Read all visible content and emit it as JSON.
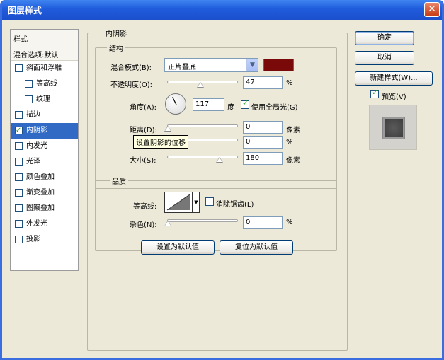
{
  "window": {
    "title": "图层样式"
  },
  "style_list": {
    "header": "样式",
    "blend_options": "混合选项:默认",
    "items": [
      {
        "label": "斜面和浮雕",
        "checked": false,
        "indent": false,
        "selected": false
      },
      {
        "label": "等高线",
        "checked": false,
        "indent": true,
        "selected": false
      },
      {
        "label": "纹理",
        "checked": false,
        "indent": true,
        "selected": false
      },
      {
        "label": "描边",
        "checked": false,
        "indent": false,
        "selected": false
      },
      {
        "label": "内阴影",
        "checked": true,
        "indent": false,
        "selected": true
      },
      {
        "label": "内发光",
        "checked": false,
        "indent": false,
        "selected": false
      },
      {
        "label": "光泽",
        "checked": false,
        "indent": false,
        "selected": false
      },
      {
        "label": "颜色叠加",
        "checked": false,
        "indent": false,
        "selected": false
      },
      {
        "label": "渐变叠加",
        "checked": false,
        "indent": false,
        "selected": false
      },
      {
        "label": "图案叠加",
        "checked": false,
        "indent": false,
        "selected": false
      },
      {
        "label": "外发光",
        "checked": false,
        "indent": false,
        "selected": false
      },
      {
        "label": "投影",
        "checked": false,
        "indent": false,
        "selected": false
      }
    ]
  },
  "inner_shadow": {
    "group_title": "内阴影",
    "structure": {
      "title": "结构",
      "blend_mode_label": "混合模式(B):",
      "blend_mode_value": "正片叠底",
      "shadow_color": "#7a0a0a",
      "opacity_label": "不透明度(O):",
      "opacity_value": "47",
      "opacity_unit": "%",
      "opacity_fraction": 0.47,
      "angle_label": "角度(A):",
      "angle_value": "117",
      "angle_unit": "度",
      "global_light_label": "使用全局光(G)",
      "global_light_checked": true,
      "distance_label": "距离(D):",
      "distance_value": "0",
      "distance_unit": "像素",
      "choke_value": "0",
      "choke_unit": "%",
      "size_label": "大小(S):",
      "size_value": "180",
      "size_unit": "像素",
      "tooltip": "设置阴影的位移"
    },
    "quality": {
      "title": "品质",
      "contour_label": "等高线:",
      "antialias_label": "消除锯齿(L)",
      "antialias_checked": false,
      "noise_label": "杂色(N):",
      "noise_value": "0",
      "noise_unit": "%"
    },
    "make_default": "设置为默认值",
    "reset_default": "复位为默认值"
  },
  "buttons": {
    "ok": "确定",
    "cancel": "取消",
    "new_style": "新建样式(W)...",
    "preview_label": "预览(V)",
    "preview_checked": true
  }
}
